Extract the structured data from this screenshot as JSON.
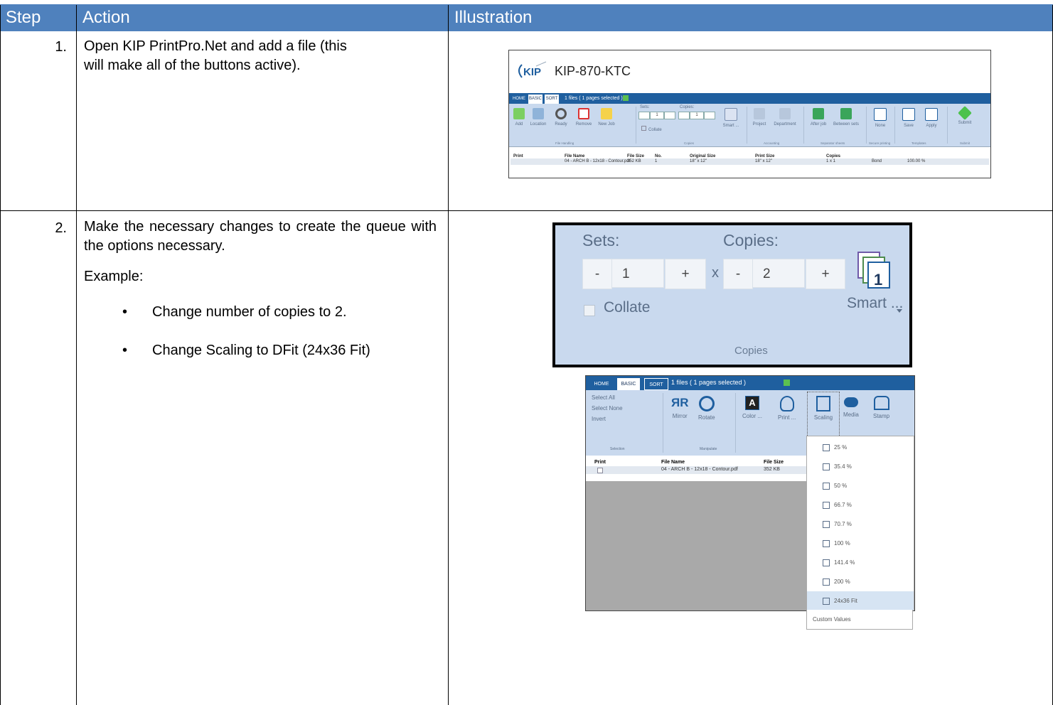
{
  "table": {
    "headers": {
      "step": "Step",
      "action": "Action",
      "illustration": "Illustration"
    },
    "rows": [
      {
        "step": "1.",
        "action": "Open KIP PrintPro.Net and add a file (this will make all of the buttons active)."
      },
      {
        "step": "2.",
        "action": "Make the necessary changes to create the queue with the options necessary.",
        "example_label": "Example:",
        "bullets": [
          "Change number of copies to 2.",
          "Change Scaling to DFit (24x36 Fit)"
        ]
      }
    ]
  },
  "shot1": {
    "logo_text": "KIP",
    "printer": "KIP-870-KTC",
    "tabs": [
      "HOME",
      "BASIC",
      "SORT"
    ],
    "status": "1 files ( 1 pages selected )",
    "sets_label": "Sets:",
    "copies_label": "Copies:",
    "sets_value": "1",
    "copies_value": "1",
    "collate": "Collate",
    "buttons": [
      "Add",
      "Location",
      "Ready",
      "Remove",
      "New Job",
      "Smart ...",
      "Project",
      "Department",
      "After job",
      "Between sets",
      "None",
      "Save",
      "Apply",
      "Submit"
    ],
    "groups": [
      "File Handling",
      "Copies",
      "Accounting",
      "Separator sheets",
      "Secure printing",
      "Templates",
      "Submit"
    ],
    "columns": [
      "Print",
      "File Name",
      "File Size",
      "No.",
      "Original Size",
      "Print Size",
      "Copies",
      "Bond",
      "100.00 %"
    ],
    "row": {
      "file": "04 - ARCH B - 12x18 - Contour.pdf",
      "size": "352 KB",
      "no": "1",
      "orig": "18\" x 12\"",
      "print": "18\" x 12\"",
      "copies": "1 x 1",
      "media": "Bond",
      "scale": "100.00 %"
    }
  },
  "shot2": {
    "sets_label": "Sets:",
    "copies_label": "Copies:",
    "sets_value": "1",
    "copies_value": "2",
    "minus": "-",
    "plus": "+",
    "times": "x",
    "collate": "Collate",
    "smart": "Smart ...",
    "group": "Copies"
  },
  "shot3": {
    "tabs": [
      "HOME",
      "BASIC",
      "SORT"
    ],
    "status": "1 files ( 1 pages selected )",
    "selection": [
      "Select All",
      "Select None",
      "Invert"
    ],
    "buttons": [
      "Mirror",
      "Rotate",
      "Color ...",
      "Print ...",
      "Scaling",
      "Media",
      "Stamp"
    ],
    "groups": [
      "Selection",
      "Manipulate"
    ],
    "columns": [
      "Print",
      "File Name",
      "File Size"
    ],
    "row": {
      "file": "04 - ARCH B - 12x18 - Contour.pdf",
      "size": "352 KB"
    },
    "scaling_options": [
      "25 %",
      "35.4 %",
      "50 %",
      "66.7 %",
      "70.7 %",
      "100 %",
      "141.4 %",
      "200 %",
      "24x36 Fit",
      "Custom Values"
    ],
    "selected": "24x36 Fit"
  }
}
